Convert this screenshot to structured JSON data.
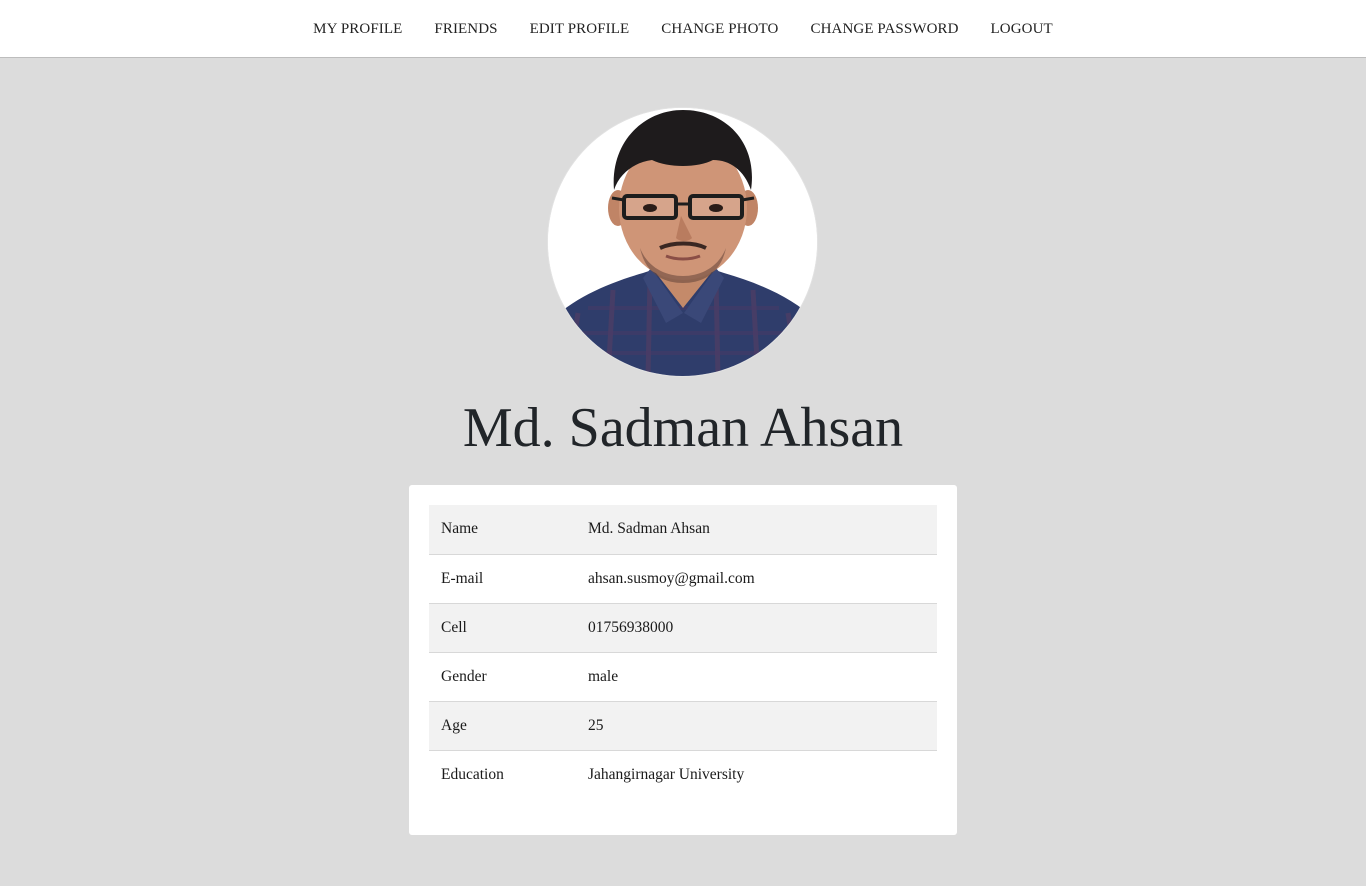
{
  "nav": {
    "items": [
      {
        "label": "MY PROFILE"
      },
      {
        "label": "FRIENDS"
      },
      {
        "label": "EDIT PROFILE"
      },
      {
        "label": "CHANGE PHOTO"
      },
      {
        "label": "CHANGE PASSWORD"
      },
      {
        "label": "LOGOUT"
      }
    ]
  },
  "profile": {
    "display_name": "Md. Sadman Ahsan",
    "photo_icon": "profile-photo"
  },
  "details": {
    "rows": [
      {
        "label": "Name",
        "value": "Md. Sadman Ahsan"
      },
      {
        "label": "E-mail",
        "value": "ahsan.susmoy@gmail.com"
      },
      {
        "label": "Cell",
        "value": "01756938000"
      },
      {
        "label": "Gender",
        "value": "male"
      },
      {
        "label": "Age",
        "value": "25"
      },
      {
        "label": "Education",
        "value": "Jahangirnagar University"
      }
    ]
  },
  "colors": {
    "page_background": "#dcdcdc",
    "navbar_background": "#ffffff",
    "card_background": "#ffffff",
    "striped_row": "#f2f2f2",
    "text": "#212529"
  }
}
